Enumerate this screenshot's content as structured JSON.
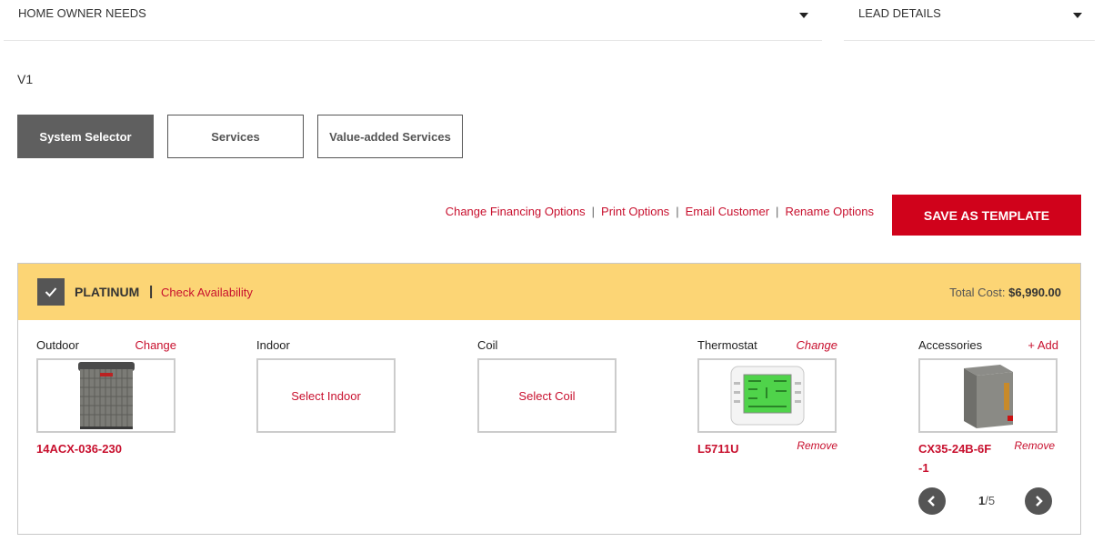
{
  "dropdowns": {
    "home_owner_needs": "HOME OWNER NEEDS",
    "lead_details": "LEAD DETAILS"
  },
  "version": "V1",
  "tabs": [
    {
      "label": "System Selector",
      "active": true
    },
    {
      "label": "Services"
    },
    {
      "label": "Value-added Services"
    }
  ],
  "links": {
    "change_financing": "Change Financing Options",
    "print": "Print Options",
    "email": "Email Customer",
    "rename": "Rename Options",
    "separator": "|"
  },
  "save_template": "SAVE AS TEMPLATE",
  "option": {
    "tier": "PLATINUM",
    "divider": "|",
    "check_availability": "Check Availability",
    "total_label": "Total Cost:",
    "total_value": "$6,990.00",
    "columns": {
      "outdoor": {
        "title": "Outdoor",
        "action": "Change",
        "model": "14ACX-036-230"
      },
      "indoor": {
        "title": "Indoor",
        "select": "Select Indoor"
      },
      "coil": {
        "title": "Coil",
        "select": "Select Coil"
      },
      "thermostat": {
        "title": "Thermostat",
        "action": "Change",
        "model": "L5711U",
        "remove": "Remove"
      },
      "accessories": {
        "title": "Accessories",
        "action": "+ Add",
        "model_line1": "CX35-24B-6F",
        "model_line2": "-1",
        "remove": "Remove"
      }
    },
    "pager": {
      "current": "1",
      "total": "/5"
    }
  },
  "colors": {
    "accent_red": "#c8102e",
    "button_red": "#d0021b",
    "header_yellow": "#fcd575",
    "active_tab": "#5f5f5f"
  },
  "icons": {
    "caret": "chevron-down-icon",
    "check": "checkmark-icon",
    "prev": "chevron-left-icon",
    "next": "chevron-right-icon"
  }
}
